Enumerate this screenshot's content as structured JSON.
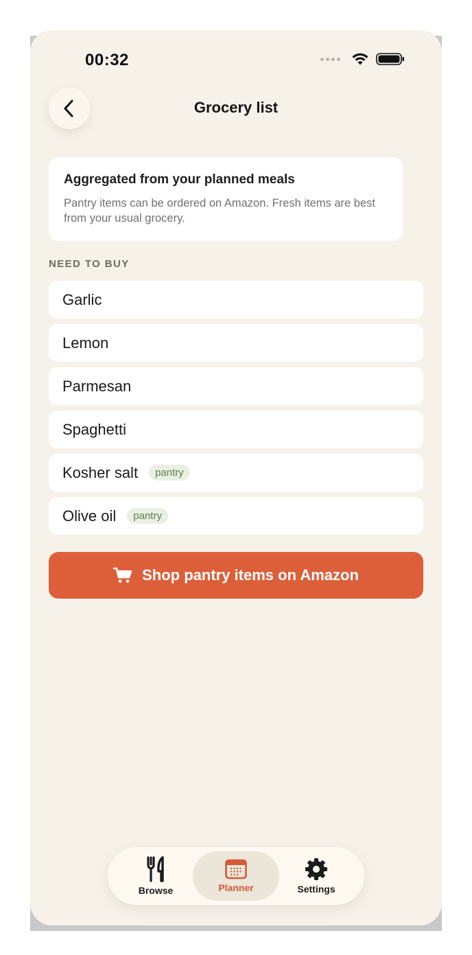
{
  "status_bar": {
    "time": "00:32"
  },
  "header": {
    "title": "Grocery list",
    "back_icon": "chevron-left-icon"
  },
  "info_card": {
    "title": "Aggregated from your planned meals",
    "body": "Pantry items can be ordered on Amazon. Fresh items are best from your usual grocery."
  },
  "section": {
    "label": "NEED TO BUY"
  },
  "items": [
    {
      "name": "Garlic",
      "badge": ""
    },
    {
      "name": "Lemon",
      "badge": ""
    },
    {
      "name": "Parmesan",
      "badge": ""
    },
    {
      "name": "Spaghetti",
      "badge": ""
    },
    {
      "name": "Kosher salt",
      "badge": "pantry"
    },
    {
      "name": "Olive oil",
      "badge": "pantry"
    }
  ],
  "shop_button": {
    "label": "Shop pantry items on Amazon",
    "icon": "cart-icon"
  },
  "tabs": [
    {
      "label": "Browse",
      "icon": "fork-knife-icon",
      "active": false
    },
    {
      "label": "Planner",
      "icon": "calendar-icon",
      "active": true
    },
    {
      "label": "Settings",
      "icon": "gear-icon",
      "active": false
    }
  ],
  "colors": {
    "background": "#f6f1e9",
    "accent": "#dc5f3a",
    "badge_bg": "#e9efe2",
    "badge_text": "#5e7d50"
  }
}
